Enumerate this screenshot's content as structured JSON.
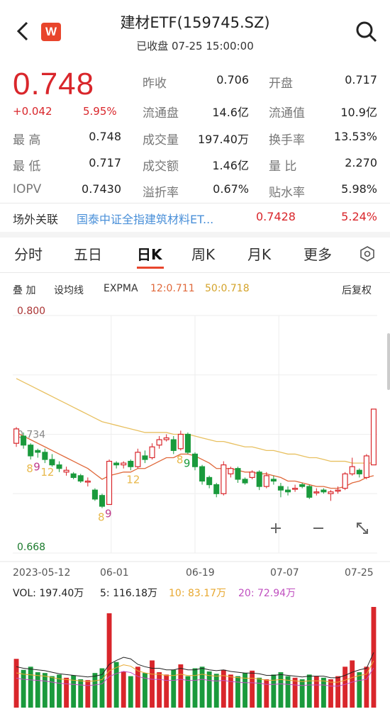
{
  "header": {
    "title": "建材ETF(159745.SZ)",
    "subtitle": "已收盘 07-25 15:00:00",
    "logo_text": "W",
    "back_icon": "back-arrow-icon",
    "search_icon": "search-icon"
  },
  "quote": {
    "price": "0.748",
    "change": "+0.042",
    "change_pct": "5.95%",
    "rows": [
      {
        "l1": "最  高",
        "v1": "0.748",
        "l2": "昨收",
        "v2": "0.706",
        "l3": "开盘",
        "v3": "0.717"
      },
      {
        "l1": "",
        "v1": "",
        "l2": "流通盘",
        "v2": "14.6亿",
        "l3": "流通值",
        "v3": "10.9亿"
      },
      {
        "l1": "最  高",
        "v1": "0.748",
        "l2": "成交量",
        "v2": "197.40万",
        "l3": "换手率",
        "v3": "13.53%"
      },
      {
        "l1": "最  低",
        "v1": "0.717",
        "l2": "成交额",
        "v2": "1.46亿",
        "l3": "量  比",
        "v3": "2.270"
      },
      {
        "l1": "IOPV",
        "v1": "0.7430",
        "l2": "溢折率",
        "v2": "0.67%",
        "l3": "贴水率",
        "v3": "5.98%"
      }
    ]
  },
  "related": {
    "label": "场外关联",
    "name": "国泰中证全指建筑材料ET...",
    "price": "0.7428",
    "pct": "5.24%"
  },
  "tabs": [
    "分时",
    "五日",
    "日K",
    "周K",
    "月K",
    "更多"
  ],
  "active_tab": "日K",
  "indicators": {
    "stack": "叠 加",
    "ma": "设均线",
    "expma": "EXPMA",
    "ema12": "12:0.711",
    "ema50": "50:0.718",
    "adjust": "后复权"
  },
  "chart_data": {
    "type": "candlestick",
    "y_max_label": "0.800",
    "y_mid_label": "0.734",
    "y_min_label": "0.668",
    "ylim": [
      0.668,
      0.8
    ],
    "x_labels": [
      "2023-05-12",
      "06-01",
      "06-19",
      "07-07",
      "07-25"
    ],
    "candles": [
      {
        "o": 0.729,
        "c": 0.737,
        "h": 0.738,
        "l": 0.727
      },
      {
        "o": 0.733,
        "c": 0.728,
        "h": 0.735,
        "l": 0.726
      },
      {
        "o": 0.728,
        "c": 0.722,
        "h": 0.729,
        "l": 0.72
      },
      {
        "o": 0.725,
        "c": 0.724,
        "h": 0.726,
        "l": 0.721
      },
      {
        "o": 0.724,
        "c": 0.72,
        "h": 0.726,
        "l": 0.718
      },
      {
        "o": 0.72,
        "c": 0.717,
        "h": 0.723,
        "l": 0.716
      },
      {
        "o": 0.717,
        "c": 0.715,
        "h": 0.719,
        "l": 0.713
      },
      {
        "o": 0.713,
        "c": 0.714,
        "h": 0.716,
        "l": 0.711
      },
      {
        "o": 0.712,
        "c": 0.71,
        "h": 0.713,
        "l": 0.709
      },
      {
        "o": 0.711,
        "c": 0.708,
        "h": 0.712,
        "l": 0.707
      },
      {
        "o": 0.708,
        "c": 0.708,
        "h": 0.71,
        "l": 0.705
      },
      {
        "o": 0.703,
        "c": 0.698,
        "h": 0.704,
        "l": 0.697
      },
      {
        "o": 0.7,
        "c": 0.694,
        "h": 0.701,
        "l": 0.693
      },
      {
        "o": 0.695,
        "c": 0.719,
        "h": 0.72,
        "l": 0.695
      },
      {
        "o": 0.718,
        "c": 0.717,
        "h": 0.719,
        "l": 0.715
      },
      {
        "o": 0.717,
        "c": 0.718,
        "h": 0.719,
        "l": 0.715
      },
      {
        "o": 0.719,
        "c": 0.716,
        "h": 0.72,
        "l": 0.714
      },
      {
        "o": 0.716,
        "c": 0.724,
        "h": 0.726,
        "l": 0.715
      },
      {
        "o": 0.722,
        "c": 0.72,
        "h": 0.725,
        "l": 0.718
      },
      {
        "o": 0.721,
        "c": 0.727,
        "h": 0.729,
        "l": 0.72
      },
      {
        "o": 0.728,
        "c": 0.731,
        "h": 0.733,
        "l": 0.726
      },
      {
        "o": 0.731,
        "c": 0.732,
        "h": 0.734,
        "l": 0.73
      },
      {
        "o": 0.731,
        "c": 0.725,
        "h": 0.733,
        "l": 0.723
      },
      {
        "o": 0.726,
        "c": 0.734,
        "h": 0.736,
        "l": 0.725
      },
      {
        "o": 0.734,
        "c": 0.724,
        "h": 0.735,
        "l": 0.723
      },
      {
        "o": 0.723,
        "c": 0.716,
        "h": 0.724,
        "l": 0.714
      },
      {
        "o": 0.716,
        "c": 0.708,
        "h": 0.717,
        "l": 0.706
      },
      {
        "o": 0.71,
        "c": 0.706,
        "h": 0.711,
        "l": 0.704
      },
      {
        "o": 0.706,
        "c": 0.701,
        "h": 0.707,
        "l": 0.699
      },
      {
        "o": 0.701,
        "c": 0.717,
        "h": 0.719,
        "l": 0.7
      },
      {
        "o": 0.712,
        "c": 0.715,
        "h": 0.716,
        "l": 0.71
      },
      {
        "o": 0.715,
        "c": 0.709,
        "h": 0.716,
        "l": 0.707
      },
      {
        "o": 0.709,
        "c": 0.707,
        "h": 0.71,
        "l": 0.706
      },
      {
        "o": 0.71,
        "c": 0.713,
        "h": 0.714,
        "l": 0.709
      },
      {
        "o": 0.713,
        "c": 0.705,
        "h": 0.714,
        "l": 0.703
      },
      {
        "o": 0.705,
        "c": 0.711,
        "h": 0.713,
        "l": 0.704
      },
      {
        "o": 0.709,
        "c": 0.708,
        "h": 0.711,
        "l": 0.706
      },
      {
        "o": 0.705,
        "c": 0.703,
        "h": 0.707,
        "l": 0.699
      },
      {
        "o": 0.703,
        "c": 0.702,
        "h": 0.705,
        "l": 0.7
      },
      {
        "o": 0.704,
        "c": 0.704,
        "h": 0.706,
        "l": 0.702
      },
      {
        "o": 0.706,
        "c": 0.705,
        "h": 0.707,
        "l": 0.704
      },
      {
        "o": 0.705,
        "c": 0.699,
        "h": 0.706,
        "l": 0.698
      },
      {
        "o": 0.702,
        "c": 0.702,
        "h": 0.704,
        "l": 0.7
      },
      {
        "o": 0.703,
        "c": 0.702,
        "h": 0.704,
        "l": 0.701
      },
      {
        "o": 0.701,
        "c": 0.702,
        "h": 0.703,
        "l": 0.697
      },
      {
        "o": 0.703,
        "c": 0.703,
        "h": 0.705,
        "l": 0.701
      },
      {
        "o": 0.704,
        "c": 0.712,
        "h": 0.713,
        "l": 0.703
      },
      {
        "o": 0.712,
        "c": 0.716,
        "h": 0.721,
        "l": 0.711
      },
      {
        "o": 0.714,
        "c": 0.712,
        "h": 0.715,
        "l": 0.71
      },
      {
        "o": 0.71,
        "c": 0.722,
        "h": 0.723,
        "l": 0.709
      },
      {
        "o": 0.717,
        "c": 0.748,
        "h": 0.748,
        "l": 0.717
      }
    ],
    "ema12": [
      0.735,
      0.733,
      0.731,
      0.729,
      0.727,
      0.725,
      0.723,
      0.721,
      0.719,
      0.717,
      0.715,
      0.712,
      0.709,
      0.711,
      0.712,
      0.713,
      0.713,
      0.715,
      0.715,
      0.717,
      0.719,
      0.721,
      0.721,
      0.723,
      0.723,
      0.722,
      0.72,
      0.718,
      0.715,
      0.715,
      0.715,
      0.714,
      0.713,
      0.713,
      0.712,
      0.712,
      0.711,
      0.71,
      0.708,
      0.708,
      0.707,
      0.706,
      0.705,
      0.705,
      0.704,
      0.704,
      0.705,
      0.707,
      0.708,
      0.71,
      0.711
    ],
    "ema50": [
      0.765,
      0.763,
      0.761,
      0.759,
      0.757,
      0.755,
      0.753,
      0.751,
      0.749,
      0.747,
      0.745,
      0.743,
      0.741,
      0.74,
      0.739,
      0.738,
      0.737,
      0.736,
      0.735,
      0.735,
      0.735,
      0.735,
      0.734,
      0.734,
      0.734,
      0.733,
      0.732,
      0.731,
      0.73,
      0.73,
      0.729,
      0.728,
      0.727,
      0.727,
      0.726,
      0.725,
      0.725,
      0.724,
      0.723,
      0.723,
      0.722,
      0.721,
      0.721,
      0.72,
      0.719,
      0.719,
      0.719,
      0.718,
      0.718,
      0.718,
      0.718
    ],
    "markers": [
      {
        "idx": 2,
        "text": "8",
        "color": "#e8b84a"
      },
      {
        "idx": 3,
        "text": "9",
        "color": "#c03a8a"
      },
      {
        "idx": 4,
        "text": "12",
        "color": "#e8b84a"
      },
      {
        "idx": 12,
        "text": "8",
        "color": "#e8b84a"
      },
      {
        "idx": 13,
        "text": "9",
        "color": "#c03a8a"
      },
      {
        "idx": 16,
        "text": "12",
        "color": "#e8b84a"
      },
      {
        "idx": 23,
        "text": "8",
        "color": "#e8b84a"
      },
      {
        "idx": 24,
        "text": "9",
        "color": "#1a9a3c"
      }
    ]
  },
  "volume": {
    "vol_label": "VOL: 197.40万",
    "ma5_label": "5: 116.18万",
    "ma10_label": "10: 83.17万",
    "ma20_label": "20: 72.94万",
    "values": [
      62,
      48,
      52,
      45,
      44,
      40,
      42,
      38,
      41,
      36,
      35,
      44,
      50,
      120,
      58,
      46,
      40,
      52,
      44,
      60,
      45,
      42,
      48,
      55,
      40,
      50,
      52,
      46,
      43,
      48,
      42,
      40,
      44,
      47,
      38,
      36,
      42,
      45,
      40,
      38,
      36,
      42,
      40,
      38,
      36,
      40,
      52,
      60,
      45,
      52,
      128
    ],
    "ma5": [
      52,
      50,
      49,
      48,
      47,
      45,
      43,
      42,
      41,
      40,
      39,
      40,
      42,
      55,
      60,
      64,
      62,
      55,
      52,
      50,
      50,
      48,
      48,
      50,
      48,
      48,
      50,
      48,
      47,
      48,
      46,
      45,
      44,
      44,
      43,
      41,
      41,
      42,
      41,
      40,
      39,
      40,
      40,
      40,
      38,
      38,
      41,
      45,
      48,
      50,
      70
    ]
  },
  "colors": {
    "up": "#d9262b",
    "down": "#1a9a3c",
    "ema12": "#e0683a",
    "ema50": "#e8c060",
    "ma5": "#222222",
    "ma10": "#e8a830",
    "ma20": "#c050c0"
  },
  "chart_controls": {
    "zoom_in_icon": "plus-icon",
    "zoom_out_icon": "minus-icon",
    "fullscreen_icon": "expand-icon"
  },
  "settings_icon": "settings-icon"
}
